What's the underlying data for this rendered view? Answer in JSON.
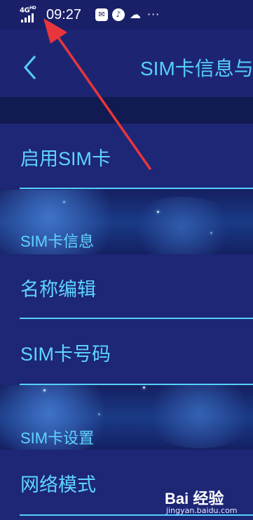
{
  "status_bar": {
    "network": "4G",
    "network_sup": "HD",
    "time": "09:27",
    "more": "···"
  },
  "header": {
    "back_icon": "chevron-left-icon",
    "title": "SIM卡信息与"
  },
  "items": {
    "enable_sim": "启用SIM卡",
    "name_edit": "名称编辑",
    "sim_number": "SIM卡号码",
    "network_mode": "网络模式"
  },
  "sections": {
    "sim_info": "SIM卡信息",
    "sim_settings": "SIM卡设置"
  },
  "watermark": {
    "logo": "Bai 经验",
    "url": "jingyan.baidu.com"
  },
  "colors": {
    "background": "#1c2470",
    "accent": "#5fd4ff",
    "annotation_arrow": "#e8363c"
  }
}
